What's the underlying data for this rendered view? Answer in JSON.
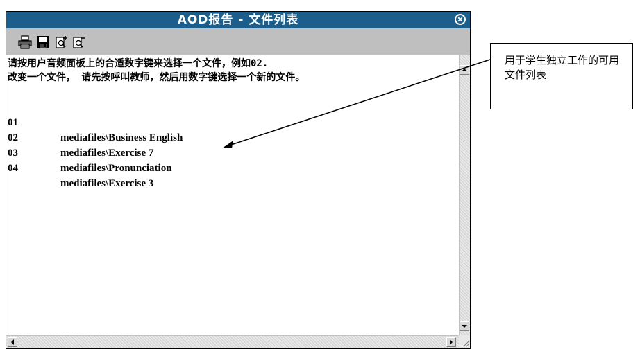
{
  "window": {
    "title": "AOD报告 - 文件列表"
  },
  "toolbar": {
    "icons": [
      "printer-icon",
      "save-icon",
      "zoom-in-icon",
      "zoom-out-icon"
    ]
  },
  "content": {
    "instruction_line1": "请按用户音频面板上的合适数字键来选择一个文件，例如02.",
    "instruction_line2": "改变一个文件， 请先按呼叫教师，然后用数字键选择一个新的文件。",
    "files": [
      {
        "num": "01",
        "path": "mediafiles\\Business English"
      },
      {
        "num": "02",
        "path": "mediafiles\\Exercise 7"
      },
      {
        "num": "03",
        "path": "mediafiles\\Pronunciation"
      },
      {
        "num": "04",
        "path": "mediafiles\\Exercise 3"
      }
    ]
  },
  "annotation": {
    "text": "用于学生独立工作的可用文件列表"
  },
  "colors": {
    "titlebar": "#1b5e8b",
    "toolbar": "#bfbfbf"
  }
}
